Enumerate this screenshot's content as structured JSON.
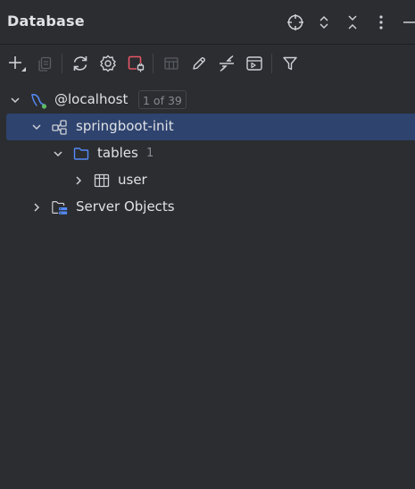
{
  "panel": {
    "title": "Database",
    "title_actions": [
      {
        "icon": "crosshair-icon",
        "label": "Select Opened File"
      },
      {
        "icon": "expand-all-icon",
        "label": "Expand All"
      },
      {
        "icon": "collapse-all-icon",
        "label": "Collapse All"
      },
      {
        "icon": "more-options-icon",
        "label": "Options"
      },
      {
        "icon": "minimize-icon",
        "label": "Hide"
      }
    ]
  },
  "toolbar": {
    "tools": [
      {
        "icon": "add-icon",
        "enabled": true
      },
      {
        "icon": "copy-icon",
        "enabled": false
      },
      {
        "icon": "refresh-icon",
        "enabled": true
      },
      {
        "icon": "settings-icon",
        "enabled": true
      },
      {
        "icon": "disconnect-icon",
        "enabled": true
      },
      {
        "icon": "table-editor-icon",
        "enabled": false
      },
      {
        "icon": "edit-icon",
        "enabled": true
      },
      {
        "icon": "jump-to-source-icon",
        "enabled": true
      },
      {
        "icon": "query-console-icon",
        "enabled": true
      },
      {
        "icon": "filter-icon",
        "enabled": true
      }
    ]
  },
  "tree": {
    "datasource": {
      "label": "@localhost",
      "badge": "1 of 39",
      "expanded": true
    },
    "schema": {
      "label": "springboot-init",
      "expanded": true,
      "selected": true
    },
    "tables_folder": {
      "label": "tables",
      "count": "1",
      "expanded": true
    },
    "table": {
      "label": "user",
      "expanded": false
    },
    "server_objects": {
      "label": "Server Objects",
      "expanded": false
    }
  },
  "colors": {
    "background": "#2b2d30",
    "selection": "#2e436e",
    "text": "#dfe1e5",
    "muted": "#868a91",
    "accent_blue": "#548af7",
    "accent_red": "#e55765",
    "status_green": "#5fb865"
  }
}
